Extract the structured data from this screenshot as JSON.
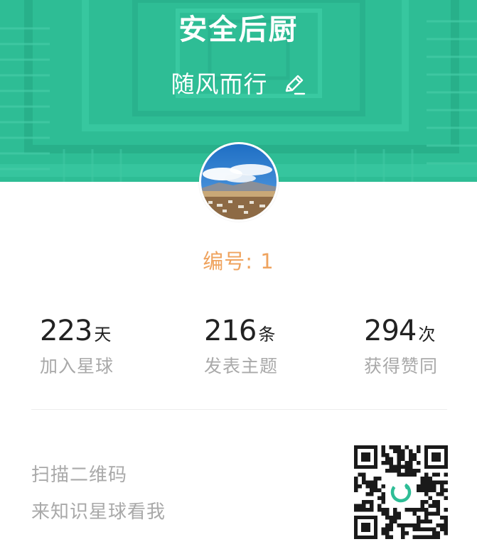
{
  "header": {
    "group_title": "安全后厨",
    "username": "随风而行",
    "edit_icon": "pencil-edit-icon",
    "background_color": "#2ebd96"
  },
  "profile": {
    "member_number_label": "编号: 1"
  },
  "stats": [
    {
      "value": "223",
      "unit": "天",
      "label": "加入星球"
    },
    {
      "value": "216",
      "unit": "条",
      "label": "发表主题"
    },
    {
      "value": "294",
      "unit": "次",
      "label": "获得赞同"
    }
  ],
  "invite": {
    "line1": "扫描二维码",
    "line2": "来知识星球看我",
    "qr_icon": "qr-code-icon",
    "accent_color": "#2ebd96"
  }
}
